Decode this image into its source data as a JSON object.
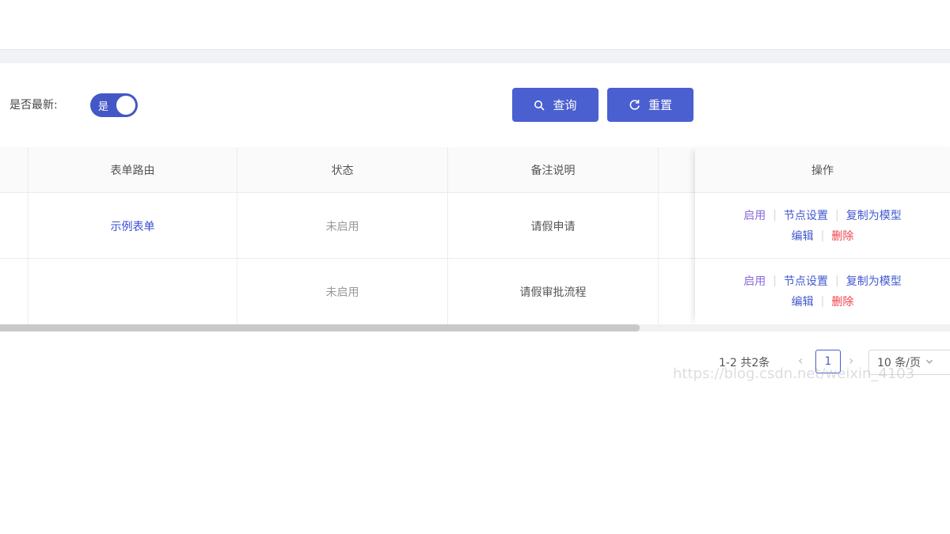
{
  "filter": {
    "label": "是否最新:",
    "switch_text": "是",
    "query_label": "查询",
    "reset_label": "重置"
  },
  "table": {
    "columns": [
      "表单路由",
      "状态",
      "备注说明",
      "操作"
    ],
    "rows": [
      {
        "route": "示例表单",
        "status": "未启用",
        "remark": "请假申请"
      },
      {
        "route": "",
        "status": "未启用",
        "remark": "请假审批流程"
      }
    ],
    "actions": {
      "enable": "启用",
      "node_settings": "节点设置",
      "copy_as_model": "复制为模型",
      "edit": "编辑",
      "delete": "删除"
    }
  },
  "pagination": {
    "total_text": "1-2 共2条",
    "current_page": "1",
    "page_size": "10 条/页",
    "prev_symbol": "‹",
    "next_symbol": "›"
  },
  "watermark": "https://blog.csdn.net/weixin_4103",
  "colors": {
    "primary": "#4a5fd0",
    "link": "#3a4bd6",
    "enable": "#8b69e0",
    "danger": "#f0434a"
  }
}
